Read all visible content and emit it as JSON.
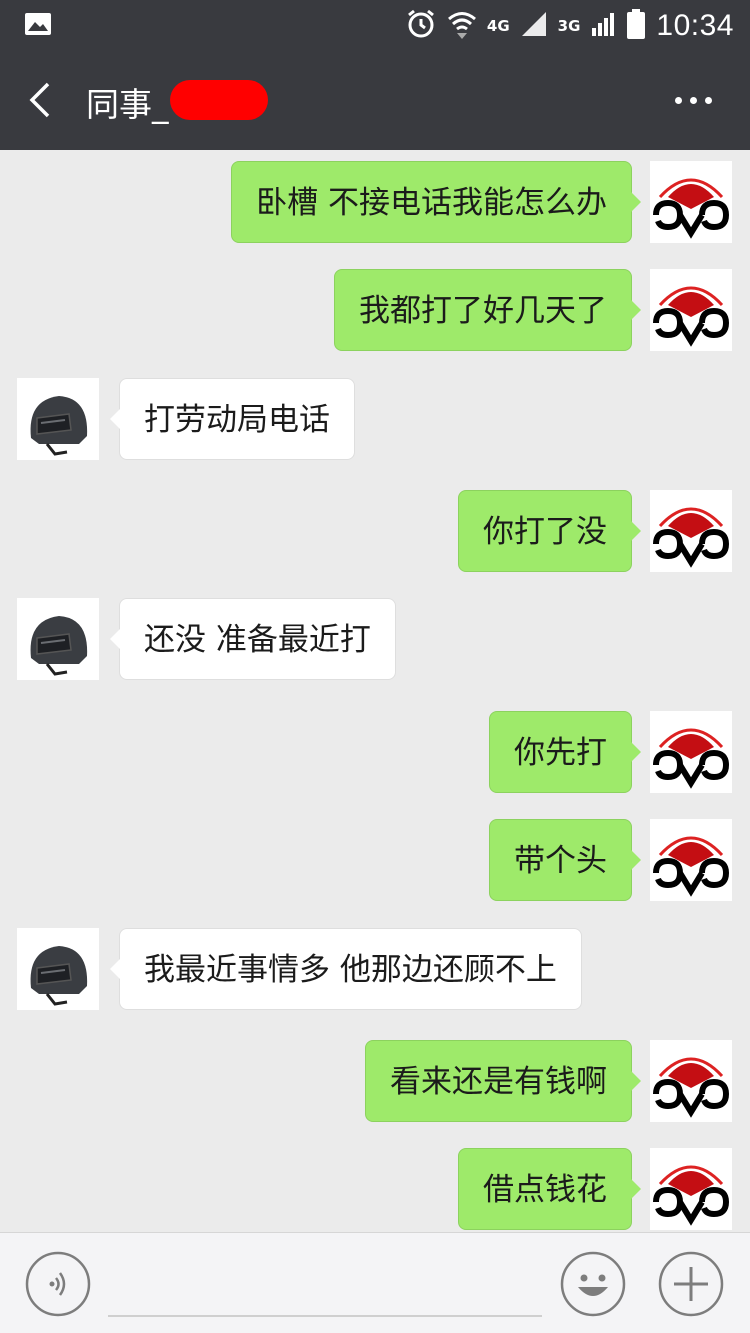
{
  "status_bar": {
    "time": "10:34",
    "network_a": "4G",
    "network_b": "3G",
    "icons": [
      "image-icon",
      "alarm-icon",
      "wifi-icon",
      "signal-icon",
      "battery-icon"
    ]
  },
  "header": {
    "title": "同事_",
    "back_icon": "chevron-left-icon",
    "more_icon": "more-icon"
  },
  "messages": [
    {
      "side": "right",
      "text": "卧槽   不接电话我能怎么办"
    },
    {
      "side": "right",
      "text": "我都打了好几天了"
    },
    {
      "side": "left",
      "text": "打劳动局电话"
    },
    {
      "side": "right",
      "text": "你打了没"
    },
    {
      "side": "left",
      "text": "还没  准备最近打"
    },
    {
      "side": "right",
      "text": "你先打"
    },
    {
      "side": "right",
      "text": "带个头"
    },
    {
      "side": "left",
      "text": "我最近事情多 他那边还顾不上"
    },
    {
      "side": "right",
      "text": "看来还是有钱啊"
    },
    {
      "side": "right",
      "text": "借点钱花"
    }
  ],
  "input_bar": {
    "icons": [
      "voice-icon",
      "emoji-icon",
      "plus-icon"
    ]
  },
  "colors": {
    "header_bg": "#393a3f",
    "sent_bubble": "#9eea6a",
    "received_bubble": "#ffffff",
    "chat_bg": "#ebebeb"
  }
}
